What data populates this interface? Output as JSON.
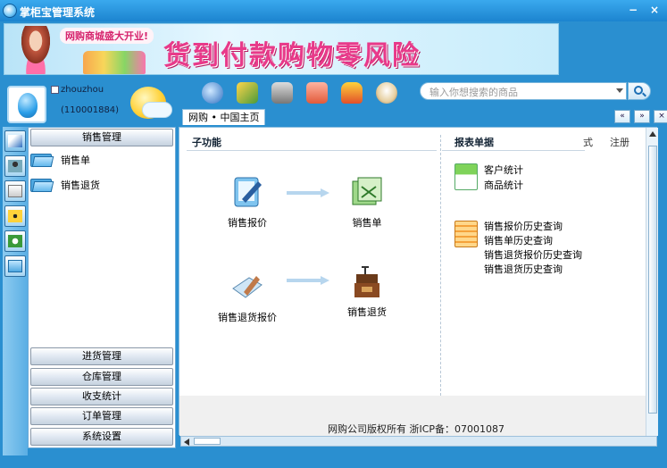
{
  "window": {
    "title": "掌柜宝管理系统",
    "minimize_glyph": "−",
    "close_glyph": "×"
  },
  "banner": {
    "small_text": "网购商城盛大开业!",
    "big_text": "货到付款购物零风险"
  },
  "user": {
    "name": "zhouzhou",
    "id": "(110001884)"
  },
  "toolbar": {
    "icons": [
      "globe-icon",
      "brush-icon",
      "camera-icon",
      "mail-icon",
      "shirt-icon",
      "coffee-icon"
    ]
  },
  "search": {
    "placeholder": "输入你想搜索的商品"
  },
  "tabs": {
    "home": "网购 • 中国主页",
    "prev_glyph": "«",
    "next_glyph": "»",
    "close_glyph": "×"
  },
  "sidebar": {
    "active_section": "销售管理",
    "items": [
      {
        "label": "销售单"
      },
      {
        "label": "销售退货"
      }
    ],
    "sections": [
      "进货管理",
      "仓库管理",
      "收支统计",
      "订单管理",
      "系统设置"
    ]
  },
  "main": {
    "sub_header": "子功能",
    "report_header": "报表单据",
    "header_link_partial": "式",
    "header_link_logout": "注册",
    "functions": [
      {
        "label": "销售报价"
      },
      {
        "label": "销售单"
      },
      {
        "label": "销售退货报价"
      },
      {
        "label": "销售退货"
      }
    ],
    "reports_group1": [
      "客户统计",
      "商品统计"
    ],
    "reports_group2": [
      "销售报价历史查询",
      "销售单历史查询",
      "销售退货报价历史查询",
      "销售退货历史查询"
    ],
    "footer": "网购公司版权所有 浙ICP备：07001087"
  },
  "colors": {
    "frame": "#2a8fd0",
    "accent": "#e83a8a"
  }
}
